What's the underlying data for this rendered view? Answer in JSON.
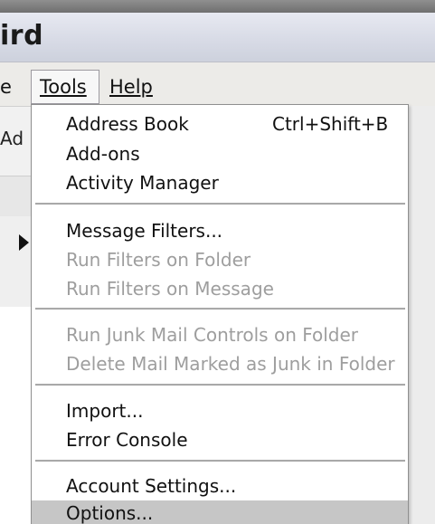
{
  "window": {
    "title_fragment": "ird"
  },
  "menubar": {
    "cut_item": "e",
    "items": [
      {
        "label": "Tools"
      },
      {
        "label": "Help"
      }
    ]
  },
  "background": {
    "toolbar_fragment": "Ad"
  },
  "tools_menu": {
    "groups": [
      [
        {
          "label": "Address Book",
          "shortcut": "Ctrl+Shift+B",
          "enabled": true
        },
        {
          "label": "Add-ons",
          "enabled": true
        },
        {
          "label": "Activity Manager",
          "enabled": true
        }
      ],
      [
        {
          "label": "Message Filters...",
          "enabled": true
        },
        {
          "label": "Run Filters on Folder",
          "enabled": false
        },
        {
          "label": "Run Filters on Message",
          "enabled": false
        }
      ],
      [
        {
          "label": "Run Junk Mail Controls on Folder",
          "enabled": false
        },
        {
          "label": "Delete Mail Marked as Junk in Folder",
          "enabled": false
        }
      ],
      [
        {
          "label": "Import...",
          "enabled": true
        },
        {
          "label": "Error Console",
          "enabled": true
        }
      ],
      [
        {
          "label": "Account Settings...",
          "enabled": true
        },
        {
          "label": "Options...",
          "enabled": true,
          "highlighted": true
        }
      ]
    ]
  }
}
